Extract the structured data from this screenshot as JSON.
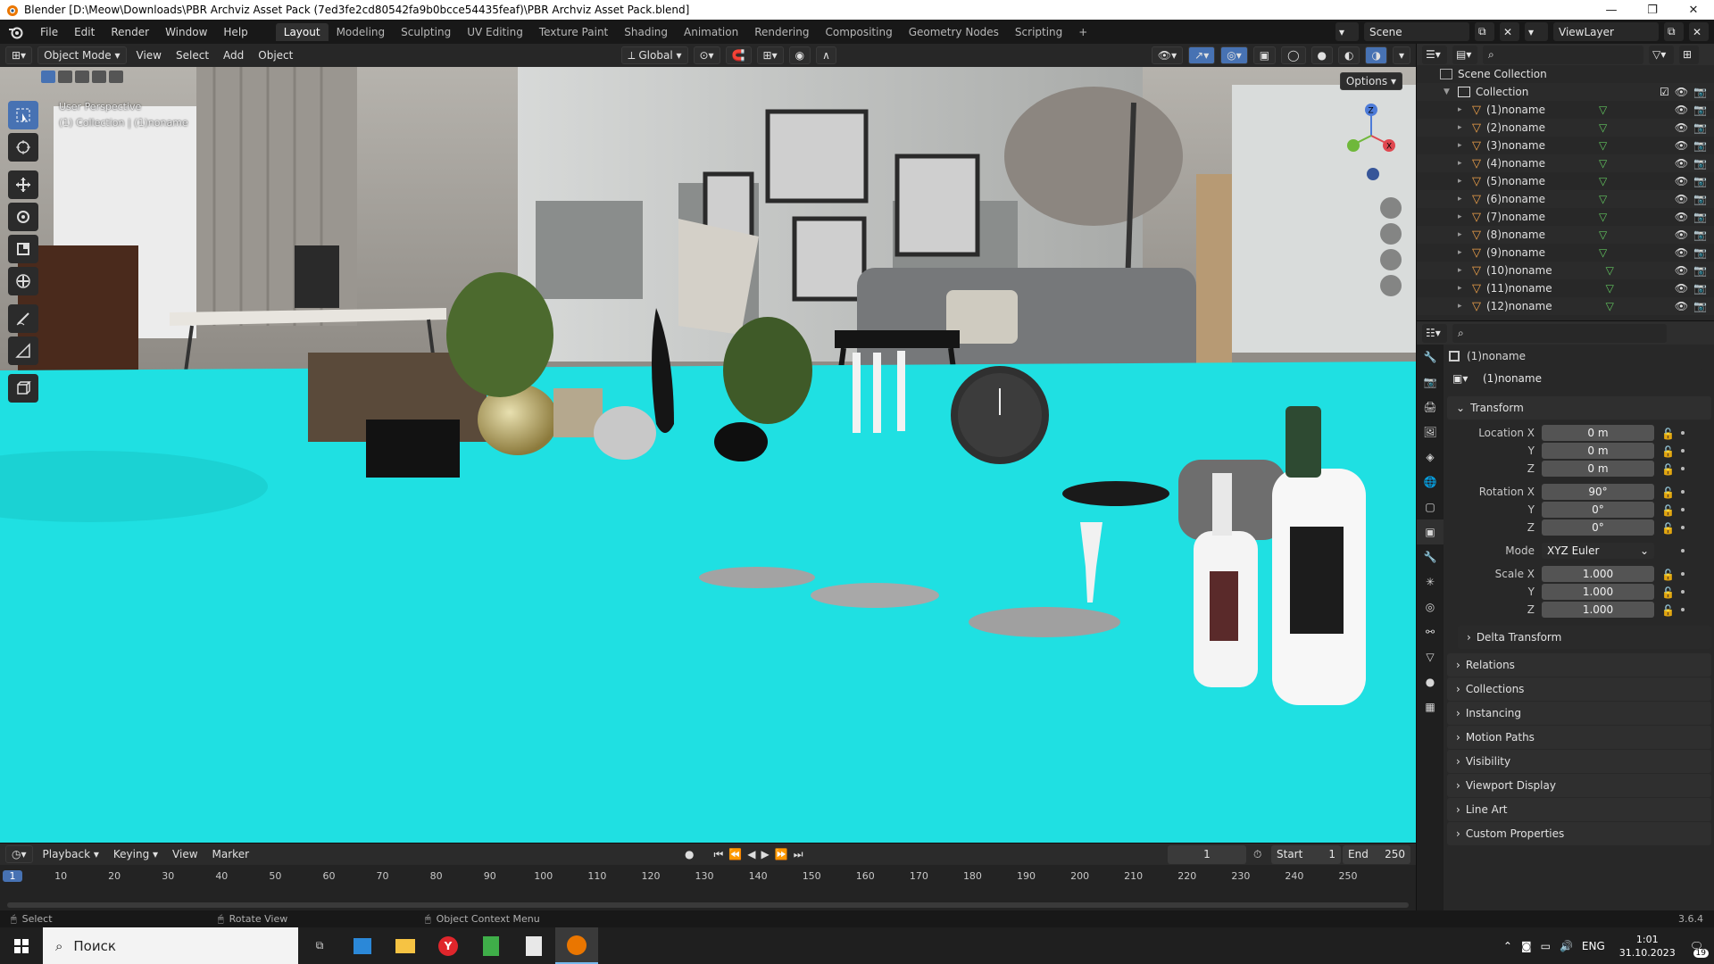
{
  "window": {
    "title": "Blender [D:\\Meow\\Downloads\\PBR Archviz Asset Pack (7ed3fe2cd80542fa9b0bcce54435feaf)\\PBR Archviz Asset Pack.blend]",
    "controls": [
      "—",
      "❐",
      "✕"
    ]
  },
  "topbar": {
    "menus": [
      "File",
      "Edit",
      "Render",
      "Window",
      "Help"
    ],
    "workspaces": [
      "Layout",
      "Modeling",
      "Sculpting",
      "UV Editing",
      "Texture Paint",
      "Shading",
      "Animation",
      "Rendering",
      "Compositing",
      "Geometry Nodes",
      "Scripting"
    ],
    "active_workspace": "Layout",
    "add_tab": "+",
    "scene": "Scene",
    "view_layer": "ViewLayer"
  },
  "viewport": {
    "mode": "Object Mode",
    "menus": [
      "View",
      "Select",
      "Add",
      "Object"
    ],
    "orientation": "Global",
    "options": "Options",
    "info_line1": "User Perspective",
    "info_line2": "(1) Collection | (1)noname",
    "floor_color": "#1fe0e2"
  },
  "outliner": {
    "scene_collection": "Scene Collection",
    "collection": "Collection",
    "items": [
      "(1)noname",
      "(2)noname",
      "(3)noname",
      "(4)noname",
      "(5)noname",
      "(6)noname",
      "(7)noname",
      "(8)noname",
      "(9)noname",
      "(10)noname",
      "(11)noname",
      "(12)noname"
    ]
  },
  "properties": {
    "object_name": "(1)noname",
    "data_name": "(1)noname",
    "transform": {
      "title": "Transform",
      "location_label": "Location X",
      "location": [
        "0 m",
        "0 m",
        "0 m"
      ],
      "rotation_label": "Rotation X",
      "rotation": [
        "90°",
        "0°",
        "0°"
      ],
      "mode_label": "Mode",
      "mode": "XYZ Euler",
      "scale_label": "Scale X",
      "scale": [
        "1.000",
        "1.000",
        "1.000"
      ],
      "axis_y": "Y",
      "axis_z": "Z",
      "delta": "Delta Transform"
    },
    "panels": [
      "Relations",
      "Collections",
      "Instancing",
      "Motion Paths",
      "Visibility",
      "Viewport Display",
      "Line Art",
      "Custom Properties"
    ]
  },
  "timeline": {
    "menus": [
      "Playback",
      "Keying",
      "View",
      "Marker"
    ],
    "current_frame": "1",
    "start_label": "Start",
    "start": "1",
    "end_label": "End",
    "end": "250",
    "ruler": [
      "1",
      "10",
      "20",
      "30",
      "40",
      "50",
      "60",
      "70",
      "80",
      "90",
      "100",
      "110",
      "120",
      "130",
      "140",
      "150",
      "160",
      "170",
      "180",
      "190",
      "200",
      "210",
      "220",
      "230",
      "240",
      "250"
    ]
  },
  "statusbar": {
    "select": "Select",
    "rotate": "Rotate View",
    "context": "Object Context Menu",
    "version": "3.6.4"
  },
  "taskbar": {
    "search_placeholder": "Поиск",
    "lang": "ENG",
    "time": "1:01",
    "date": "31.10.2023",
    "notif": "19"
  }
}
